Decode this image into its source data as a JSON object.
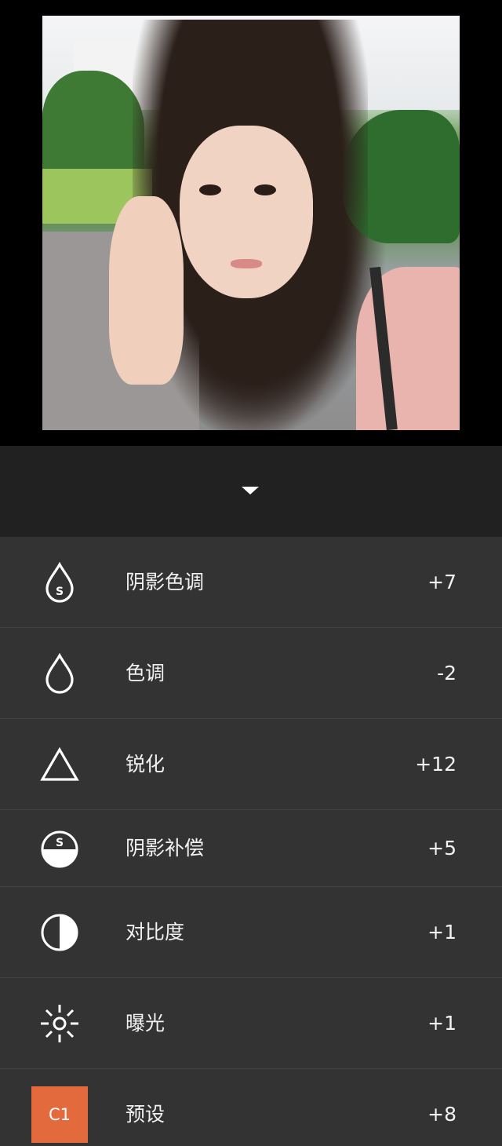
{
  "adjustments": [
    {
      "label": "阴影色调",
      "value": "+7",
      "icon": "shadow-tint-drop-icon"
    },
    {
      "label": "色调",
      "value": "-2",
      "icon": "tint-drop-icon"
    },
    {
      "label": "锐化",
      "value": "+12",
      "icon": "sharpen-triangle-icon"
    },
    {
      "label": "阴影补偿",
      "value": "+5",
      "icon": "shadow-save-icon"
    },
    {
      "label": "对比度",
      "value": "+1",
      "icon": "contrast-icon"
    },
    {
      "label": "曝光",
      "value": "+1",
      "icon": "exposure-sun-icon"
    },
    {
      "label": "预设",
      "value": "+8",
      "icon": "preset-badge-icon",
      "badge": "C1",
      "badge_color": "#e26a3d"
    }
  ],
  "colors": {
    "panel_bg": "#333333",
    "handle_bg": "#212121",
    "accent": "#e26a3d"
  }
}
